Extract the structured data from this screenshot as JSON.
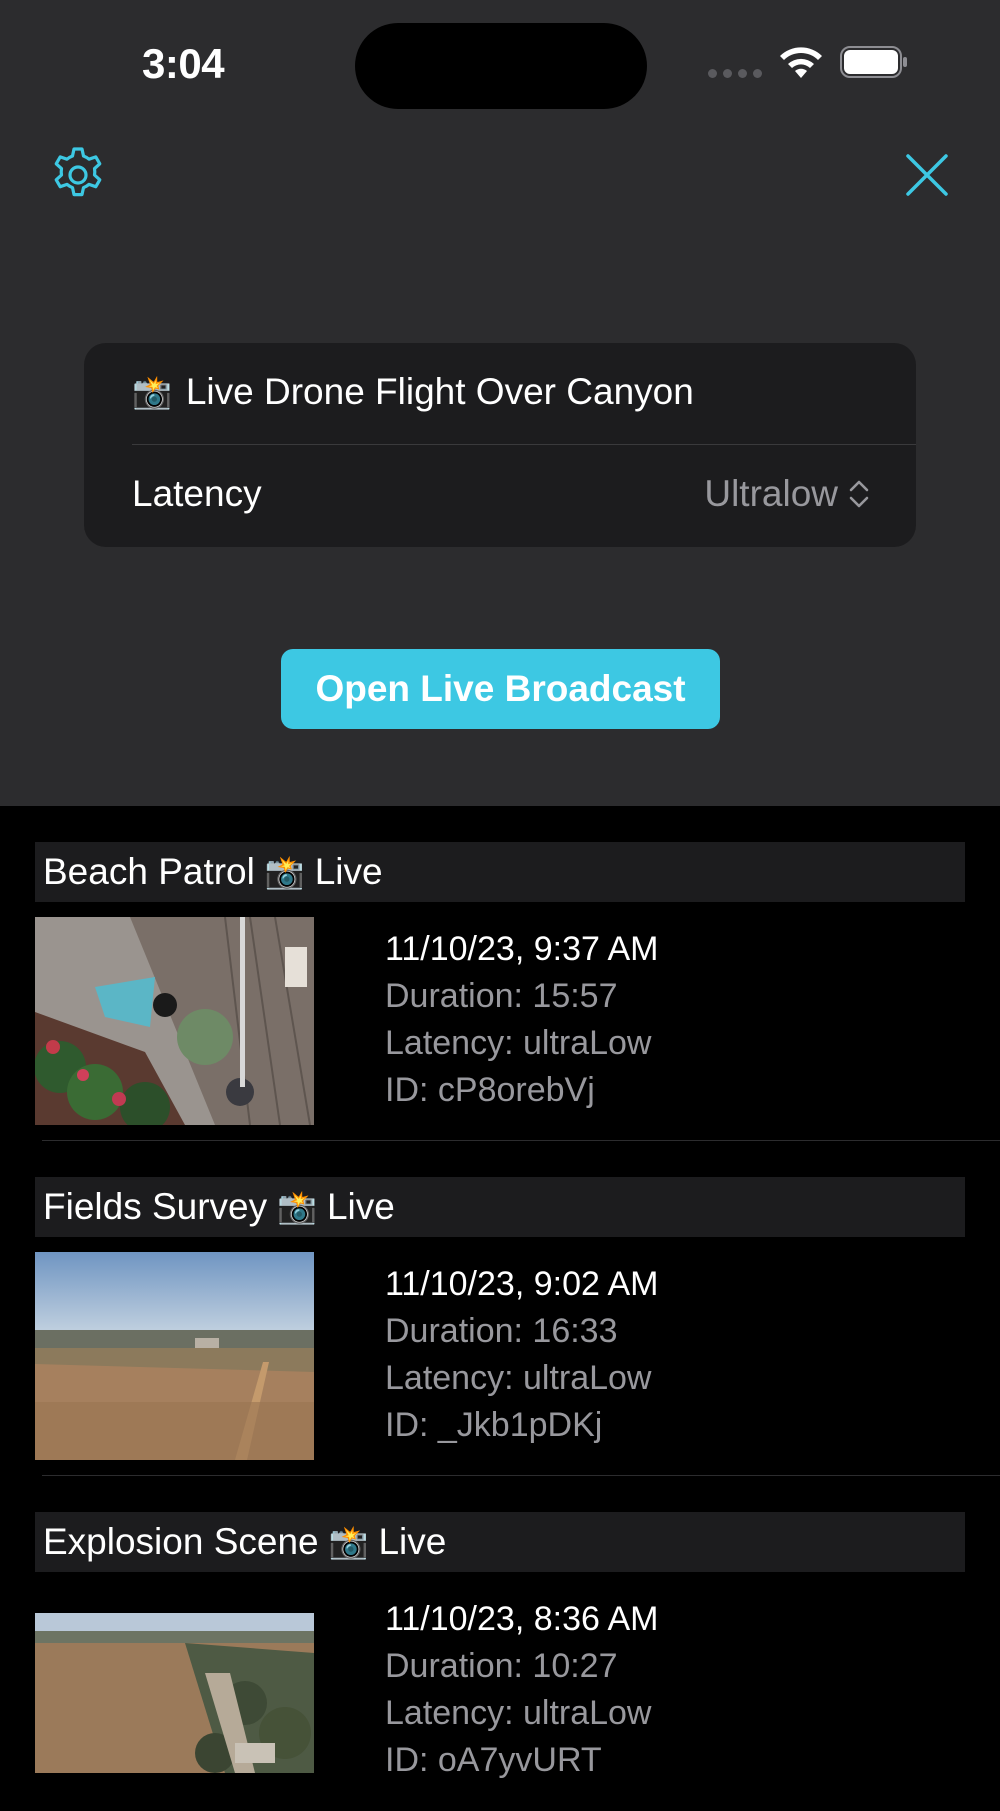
{
  "status_bar": {
    "time": "3:04"
  },
  "nav": {
    "settings_icon": "gear-icon",
    "close_icon": "close-icon",
    "accent": "#3dc8e3"
  },
  "stream_card": {
    "emoji": "📸",
    "title": "Live Drone Flight Over Canyon",
    "latency_label": "Latency",
    "latency_value": "Ultralow"
  },
  "primary_button": {
    "label": "Open Live Broadcast"
  },
  "broadcasts": [
    {
      "name": "Beach Patrol",
      "emoji": "📸",
      "tag": "Live",
      "date": "11/10/23, 9:37 AM",
      "duration": "Duration: 15:57",
      "latency": "Latency: ultraLow",
      "id": "ID: cP8orebVj"
    },
    {
      "name": "Fields Survey",
      "emoji": "📸",
      "tag": "Live",
      "date": "11/10/23, 9:02 AM",
      "duration": "Duration: 16:33",
      "latency": "Latency: ultraLow",
      "id": "ID: _Jkb1pDKj"
    },
    {
      "name": "Explosion Scene",
      "emoji": "📸",
      "tag": "Live",
      "date": "11/10/23, 8:36 AM",
      "duration": "Duration: 10:27",
      "latency": "Latency: ultraLow",
      "id": "ID: oA7yvURT"
    }
  ]
}
